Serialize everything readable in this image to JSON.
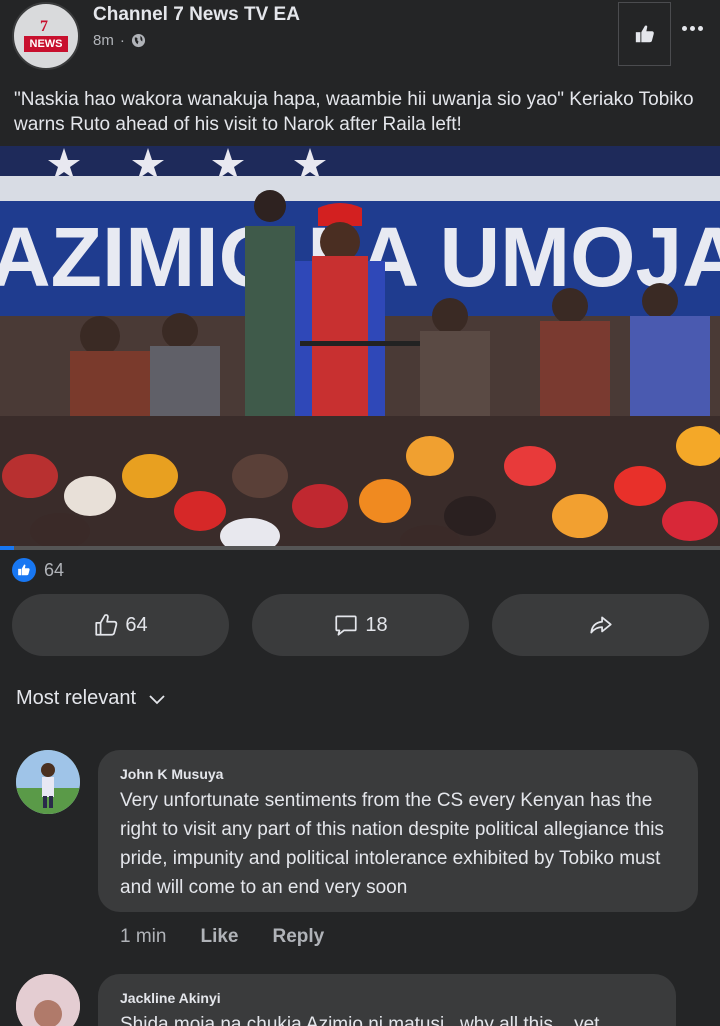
{
  "post": {
    "page_name": "Channel 7 News TV EA",
    "logo_text": "NEWS",
    "logo_number": "7",
    "time": "8m",
    "separator": "·",
    "audience_icon": "globe-icon",
    "caption": "\"Naskia hao wakora wanakuja hapa, waambie hii uwanja sio yao\" Keriako Tobiko warns Ruto ahead of his visit to Narok after Raila left!",
    "photo_banner_text": "AZIMIO LA UMOJA",
    "reaction_count": "64",
    "video_progress": 0.02
  },
  "actions": {
    "like_count": "64",
    "comment_count": "18",
    "like_icon": "thumbs-up-icon",
    "comment_icon": "comment-icon",
    "share_icon": "share-icon"
  },
  "sort": {
    "label": "Most relevant"
  },
  "comments": [
    {
      "author": "John K Musuya",
      "text": "Very unfortunate sentiments from the CS every Kenyan has the right to visit any part of this nation despite political allegiance this pride, impunity and political intolerance exhibited by Tobiko must and will come to an end very soon",
      "time": "1 min",
      "like_label": "Like",
      "reply_label": "Reply"
    },
    {
      "author": "Jackline Akinyi",
      "text": "Shida moja na chukia Azimio ni matusi...why all this....yet"
    }
  ],
  "colors": {
    "background": "#242526",
    "surface": "#3a3b3c",
    "accent": "#1877f2",
    "brand_red": "#c8102e"
  }
}
